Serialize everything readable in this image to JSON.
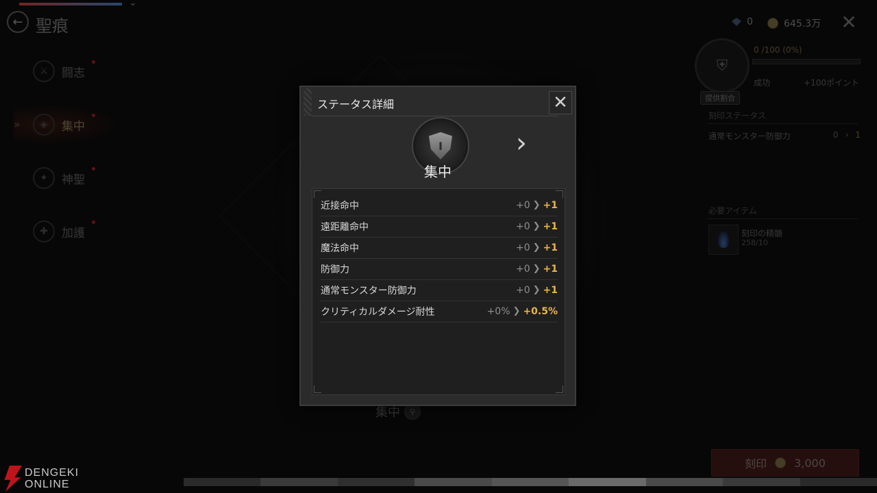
{
  "header": {
    "title": "聖痕"
  },
  "nav": [
    {
      "label": "闘志",
      "active": false
    },
    {
      "label": "集中",
      "active": true
    },
    {
      "label": "神聖",
      "active": false
    },
    {
      "label": "加護",
      "active": false
    }
  ],
  "currency": {
    "gems": "0",
    "gold": "645.3万"
  },
  "right_panel": {
    "emblem_tag": "提供割合",
    "progress_text": "0 /100 (0%)",
    "progress_fraction": 0,
    "success_label": "成功",
    "success_value": "+100ポイント",
    "engrave_status_heading": "刻印ステータス",
    "engrave_status_row": {
      "label": "通常モンスター防御力",
      "old": "0",
      "new": "1"
    },
    "required_items_heading": "必要アイテム",
    "item_name": "刻印の精髄",
    "item_count": "258/10",
    "engrave_button_label": "刻印",
    "engrave_button_cost": "3,000"
  },
  "center_label": "集中",
  "modal": {
    "title": "ステータス詳細",
    "skill_name": "集中",
    "stats": [
      {
        "label": "近接命中",
        "old": "+0",
        "new": "+1"
      },
      {
        "label": "遠距離命中",
        "old": "+0",
        "new": "+1"
      },
      {
        "label": "魔法命中",
        "old": "+0",
        "new": "+1"
      },
      {
        "label": "防御力",
        "old": "+0",
        "new": "+1"
      },
      {
        "label": "通常モンスター防御力",
        "old": "+0",
        "new": "+1"
      },
      {
        "label": "クリティカルダメージ耐性",
        "old": "+0%",
        "new": "+0.5%"
      }
    ]
  },
  "watermark": {
    "line1": "DENGEKI",
    "line2": "ONLINE"
  },
  "colors": {
    "accent_gold": "#e8b54a",
    "button_red": "#3a1616"
  }
}
